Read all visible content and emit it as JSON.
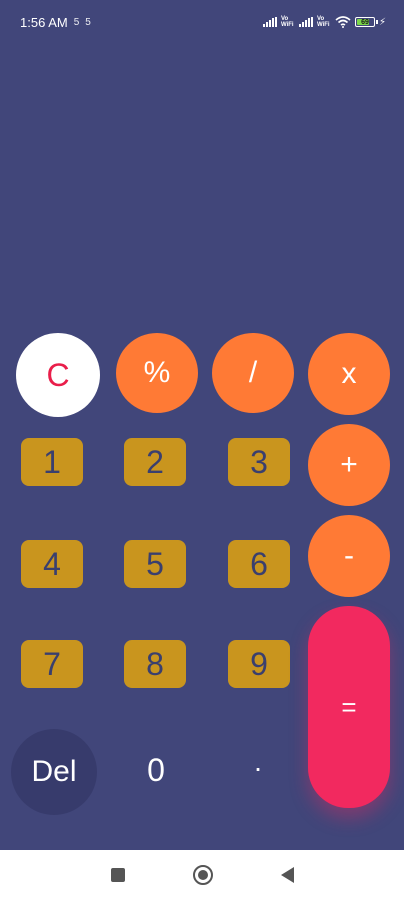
{
  "status_bar": {
    "time": "1:56 AM",
    "notif_icon_1": "5",
    "notif_icon_2": "5",
    "vowifi_1": "Vo WiFi",
    "vowifi_2": "Vo WiFi",
    "battery_level": "69"
  },
  "keys": {
    "clear": "C",
    "percent": "%",
    "divide": "/",
    "multiply": "x",
    "plus": "+",
    "minus": "-",
    "equals": "=",
    "one": "1",
    "two": "2",
    "three": "3",
    "four": "4",
    "five": "5",
    "six": "6",
    "seven": "7",
    "eight": "8",
    "nine": "9",
    "zero": "0",
    "dot": ".",
    "delete": "Del"
  },
  "colors": {
    "background": "#41467a",
    "operator": "#ff7a35",
    "number": "#c9951e",
    "equals": "#f2295f",
    "clear_text": "#e91e4a"
  },
  "nav_bar": {
    "recents_icon": "square-icon",
    "home_icon": "circle-icon",
    "back_icon": "triangle-back-icon"
  }
}
